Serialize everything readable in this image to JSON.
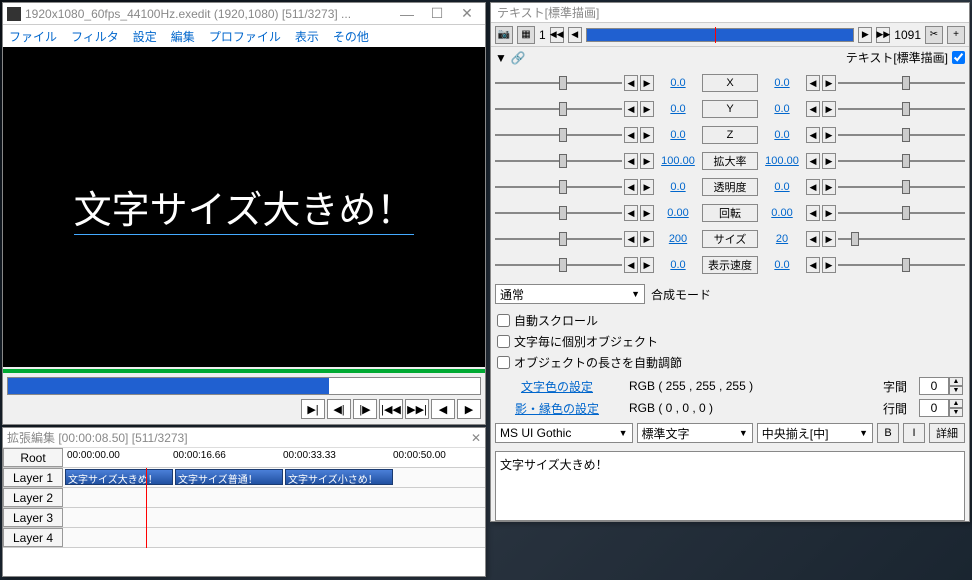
{
  "preview": {
    "title": "1920x1080_60fps_44100Hz.exedit (1920,1080)  [511/3273] ...",
    "menu": [
      "ファイル",
      "フィルタ",
      "設定",
      "編集",
      "プロファイル",
      "表示",
      "その他"
    ],
    "canvas_text": "文字サイズ大きめ！"
  },
  "timeline": {
    "title": "拡張編集 [00:00:08.50] [511/3273]",
    "root": "Root",
    "ruler": [
      "00:00:00.00",
      "00:00:16.66",
      "00:00:33.33",
      "00:00:50.00"
    ],
    "layers": [
      "Layer 1",
      "Layer 2",
      "Layer 3",
      "Layer 4"
    ],
    "clips": [
      "文字サイズ大きめ！",
      "文字サイズ普通！",
      "文字サイズ小さめ！"
    ]
  },
  "prop": {
    "title": "テキスト[標準描画]",
    "frame_start": "1",
    "frame_end": "1091",
    "header_label": "テキスト[標準描画]",
    "params": [
      {
        "label": "X",
        "l": "0.0",
        "r": "0.0"
      },
      {
        "label": "Y",
        "l": "0.0",
        "r": "0.0"
      },
      {
        "label": "Z",
        "l": "0.0",
        "r": "0.0"
      },
      {
        "label": "拡大率",
        "l": "100.00",
        "r": "100.00"
      },
      {
        "label": "透明度",
        "l": "0.0",
        "r": "0.0"
      },
      {
        "label": "回転",
        "l": "0.00",
        "r": "0.00"
      },
      {
        "label": "サイズ",
        "l": "200",
        "r": "20"
      },
      {
        "label": "表示速度",
        "l": "0.0",
        "r": "0.0"
      }
    ],
    "blend_mode": "通常",
    "blend_label": "合成モード",
    "checks": [
      "自動スクロール",
      "文字毎に個別オブジェクト",
      "オブジェクトの長さを自動調節"
    ],
    "text_color_label": "文字色の設定",
    "text_color_val": "RGB ( 255 , 255 , 255 )",
    "shadow_color_label": "影・縁色の設定",
    "shadow_color_val": "RGB ( 0 , 0 , 0 )",
    "spacing_label": "字間",
    "spacing_val": "0",
    "linespace_label": "行間",
    "linespace_val": "0",
    "font": "MS UI Gothic",
    "font_style": "標準文字",
    "align": "中央揃え[中]",
    "bold": "B",
    "italic": "I",
    "detail": "詳細",
    "text_content": "文字サイズ大きめ！"
  }
}
